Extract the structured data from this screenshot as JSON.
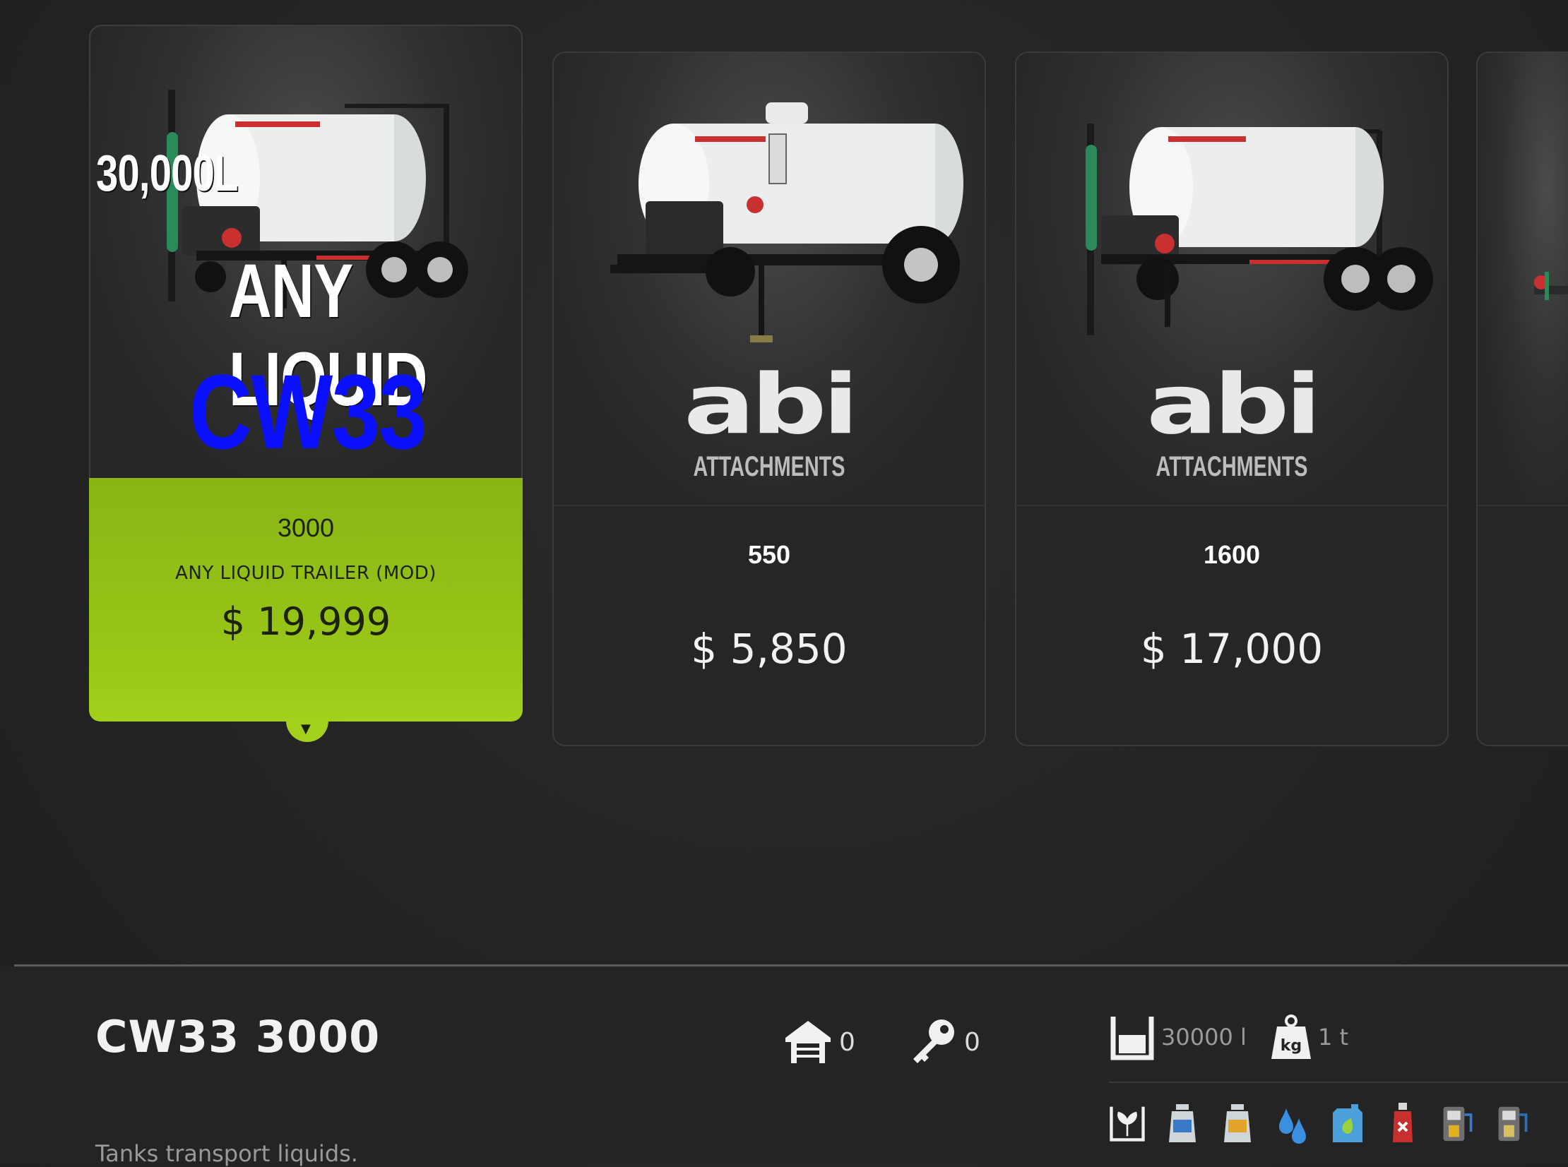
{
  "cards": [
    {
      "overlay": {
        "capacity": "30,000L",
        "liquid": "ANY LIQUID",
        "brand": "CW33"
      },
      "model": "3000",
      "name": "ANY LIQUID TRAILER (MOD)",
      "price": "$ 19,999",
      "selected": true
    },
    {
      "brand_logo": {
        "word": "abi",
        "sub": "ATTACHMENTS"
      },
      "model": "550",
      "price": "$ 5,850"
    },
    {
      "brand_logo": {
        "word": "abi",
        "sub": "ATTACHMENTS"
      },
      "model": "1600",
      "price": "$ 17,000"
    }
  ],
  "details": {
    "title": "CW33 3000",
    "description": "Tanks transport liquids.",
    "owned_count": "0",
    "leased_count": "0",
    "capacity": "30000 l",
    "weight": "1 t"
  },
  "fill_types": [
    "seedling-icon",
    "milk-can-icon",
    "honey-can-icon",
    "water-drop-icon",
    "liquid-fertilizer-icon",
    "herbicide-icon",
    "diesel-pump-icon",
    "def-pump-icon"
  ],
  "colors": {
    "accent": "#96c316",
    "background": "#232423",
    "overlay_blue": "#0a10ff"
  }
}
